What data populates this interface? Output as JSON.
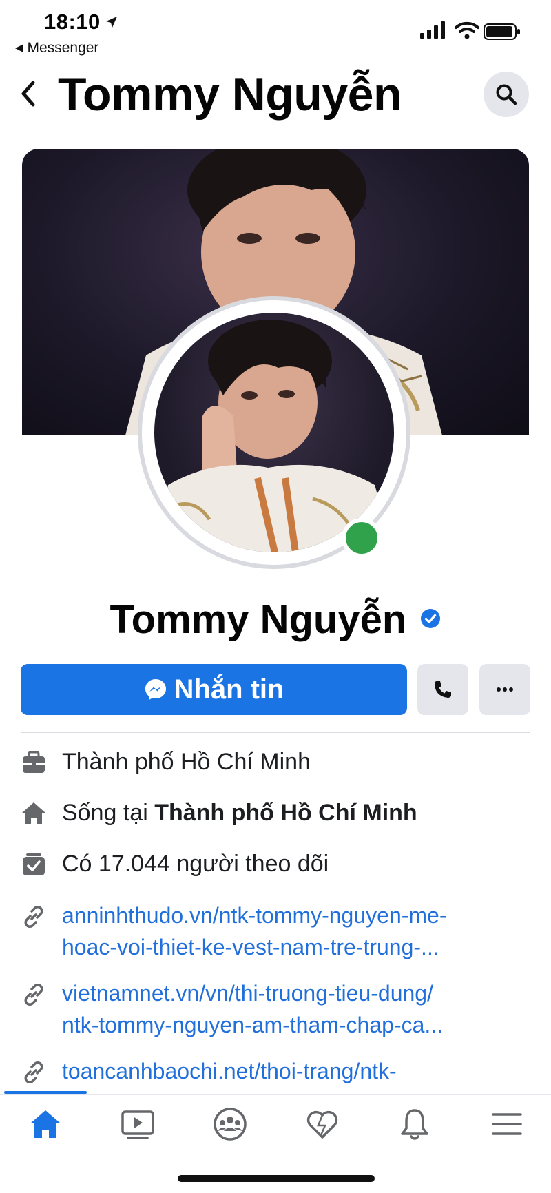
{
  "status_bar": {
    "time": "18:10",
    "back_app": "Messenger"
  },
  "header": {
    "title": "Tommy Nguyễn"
  },
  "profile": {
    "name": "Tommy Nguyễn",
    "verified": true,
    "online": true
  },
  "actions": {
    "message_label": "Nhắn tin"
  },
  "info": {
    "work": "Thành phố Hồ Chí Minh",
    "lives_prefix": "Sống tại ",
    "lives_city": "Thành phố Hồ Chí Minh",
    "followers": "Có 17.044 người theo dõi"
  },
  "links": [
    {
      "line1": "anninhthudo.vn/ntk-tommy-nguyen-me-",
      "line2": "hoac-voi-thiet-ke-vest-nam-tre-trung-..."
    },
    {
      "line1": "vietnamnet.vn/vn/thi-truong-tieu-dung/",
      "line2": "ntk-tommy-nguyen-am-tham-chap-ca..."
    },
    {
      "line1": "toancanhbaochi.net/thoi-trang/ntk-"
    }
  ],
  "bottom_nav": {
    "active": "home",
    "items": [
      "home-icon",
      "video-icon",
      "groups-icon",
      "dating-icon",
      "notifications-icon",
      "menu-icon"
    ]
  },
  "colors": {
    "accent": "#1b74e4",
    "link": "#216fdb",
    "online": "#31a24c",
    "button_gray": "#e4e6eb"
  }
}
